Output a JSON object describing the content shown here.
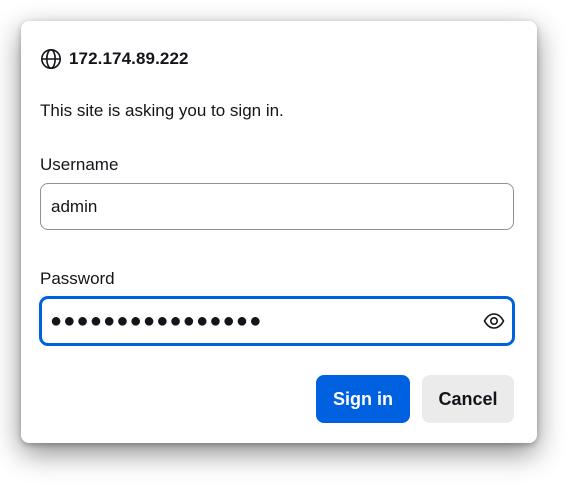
{
  "dialog": {
    "origin": "172.174.89.222",
    "origin_icon": "globe-icon",
    "prompt": "This site is asking you to sign in.",
    "username": {
      "label": "Username",
      "value": "admin"
    },
    "password": {
      "label": "Password",
      "masked_value": "●●●●●●●●●●●●●●●●",
      "reveal_icon": "eye-icon"
    },
    "buttons": {
      "sign_in": "Sign in",
      "cancel": "Cancel"
    },
    "colors": {
      "accent": "#0061e0",
      "text": "#15141a",
      "secondary_button": "#ebebeb",
      "field_border": "#8f8f9d"
    }
  }
}
